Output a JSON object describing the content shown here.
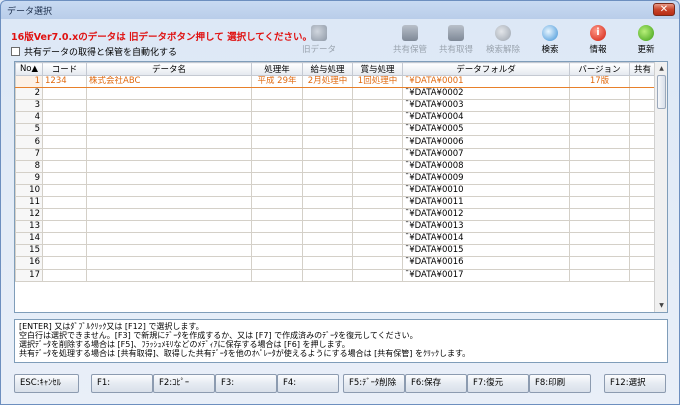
{
  "window": {
    "title": "データ選択",
    "close_label": "✕"
  },
  "notice": "16版Ver7.0.xのデータは 旧データボタン押して 選択してください。→",
  "auto_checkbox": {
    "label": "共有データの取得と保管を自動化する"
  },
  "toolbar": {
    "old_data": "旧データ",
    "share_save": "共有保管",
    "share_get": "共有取得",
    "search_clear": "検索解除",
    "search": "検索",
    "info": "情報",
    "update": "更新"
  },
  "colors": {
    "accent": "#e06a10",
    "notice": "#e01010"
  },
  "grid": {
    "columns": [
      "No▲",
      "コード",
      "データ名",
      "処理年",
      "給与処理",
      "賞与処理",
      "データフォルダ",
      "バージョン",
      "共有"
    ],
    "rows": [
      [
        "1",
        "1234",
        "株式会社ABC",
        "平成 29年",
        "2月処理中",
        "1回処理中",
        "¯¥DATA¥0001",
        "17版",
        ""
      ],
      [
        "2",
        "",
        "",
        "",
        "",
        "",
        "¯¥DATA¥0002",
        "",
        ""
      ],
      [
        "3",
        "",
        "",
        "",
        "",
        "",
        "¯¥DATA¥0003",
        "",
        ""
      ],
      [
        "4",
        "",
        "",
        "",
        "",
        "",
        "¯¥DATA¥0004",
        "",
        ""
      ],
      [
        "5",
        "",
        "",
        "",
        "",
        "",
        "¯¥DATA¥0005",
        "",
        ""
      ],
      [
        "6",
        "",
        "",
        "",
        "",
        "",
        "¯¥DATA¥0006",
        "",
        ""
      ],
      [
        "7",
        "",
        "",
        "",
        "",
        "",
        "¯¥DATA¥0007",
        "",
        ""
      ],
      [
        "8",
        "",
        "",
        "",
        "",
        "",
        "¯¥DATA¥0008",
        "",
        ""
      ],
      [
        "9",
        "",
        "",
        "",
        "",
        "",
        "¯¥DATA¥0009",
        "",
        ""
      ],
      [
        "10",
        "",
        "",
        "",
        "",
        "",
        "¯¥DATA¥0010",
        "",
        ""
      ],
      [
        "11",
        "",
        "",
        "",
        "",
        "",
        "¯¥DATA¥0011",
        "",
        ""
      ],
      [
        "12",
        "",
        "",
        "",
        "",
        "",
        "¯¥DATA¥0012",
        "",
        ""
      ],
      [
        "13",
        "",
        "",
        "",
        "",
        "",
        "¯¥DATA¥0013",
        "",
        ""
      ],
      [
        "14",
        "",
        "",
        "",
        "",
        "",
        "¯¥DATA¥0014",
        "",
        ""
      ],
      [
        "15",
        "",
        "",
        "",
        "",
        "",
        "¯¥DATA¥0015",
        "",
        ""
      ],
      [
        "16",
        "",
        "",
        "",
        "",
        "",
        "¯¥DATA¥0016",
        "",
        ""
      ],
      [
        "17",
        "",
        "",
        "",
        "",
        "",
        "¯¥DATA¥0017",
        "",
        ""
      ]
    ]
  },
  "info_lines": [
    "[ENTER] 又はﾀﾞﾌﾞﾙｸﾘｯｸ又は [F12] で選択します。",
    "空白行は選択できません。[F3] で新規にﾃﾞｰﾀを作成するか、又は [F7] で作成済みのﾃﾞｰﾀを復元してください。",
    "選択ﾃﾞｰﾀを削除する場合は [F5]、ﾌﾗｯｼｭﾒﾓﾘなどのﾒﾃﾞｨｱに保存する場合は [F6] を押します。",
    "共有ﾃﾞｰﾀを処理する場合は [共有取得]、取得した共有ﾃﾞｰﾀを他のｵﾍﾟﾚｰﾀが使えるようにする場合は [共有保管] をｸﾘｯｸします。"
  ],
  "fkeys": {
    "esc": "ESC:ｷｬﾝｾﾙ",
    "f1": "F1:",
    "f2": "F2:ｺﾋﾟｰ",
    "f3": "F3:",
    "f4": "F4:",
    "f5": "F5:ﾃﾞｰﾀ削除",
    "f6": "F6:保存",
    "f7": "F7:復元",
    "f8": "F8:印刷",
    "f12": "F12:選択"
  }
}
